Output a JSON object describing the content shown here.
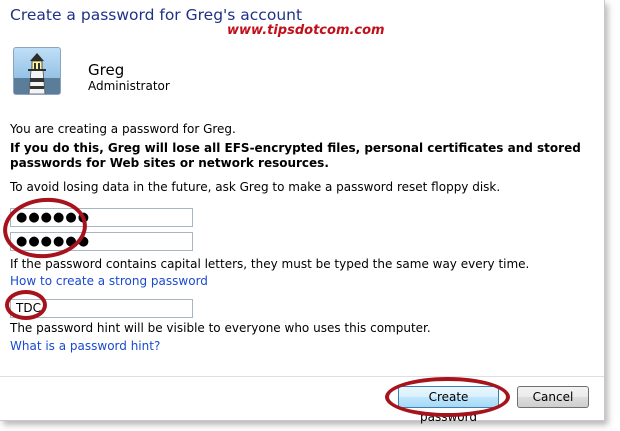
{
  "dialog": {
    "title": "Create a password for Greg's account",
    "watermark": "www.tipsdotcom.com"
  },
  "account": {
    "name": "Greg",
    "role": "Administrator",
    "avatar_icon": "lighthouse-icon"
  },
  "messages": {
    "intro": "You are creating a password for Greg.",
    "warning": "If you do this, Greg will lose all EFS-encrypted files, personal certificates and stored passwords for Web sites or network resources.",
    "reset_advice": "To avoid losing data in the future, ask Greg to make a password reset floppy disk.",
    "case_note": "If the password contains capital letters, they must be typed the same way every time.",
    "strong_password_link": "How to create a strong password",
    "hint_note": "The password hint will be visible to everyone who uses this computer.",
    "hint_link": "What is a password hint?"
  },
  "form": {
    "new_password": "●●●●●●",
    "confirm_password": "●●●●●●",
    "password_hint": "TDC"
  },
  "buttons": {
    "create": "Create password",
    "cancel": "Cancel"
  },
  "colors": {
    "title": "#1e3287",
    "link": "#1a4ad0",
    "watermark": "#c0101a",
    "highlight_ring": "#a6131c"
  }
}
